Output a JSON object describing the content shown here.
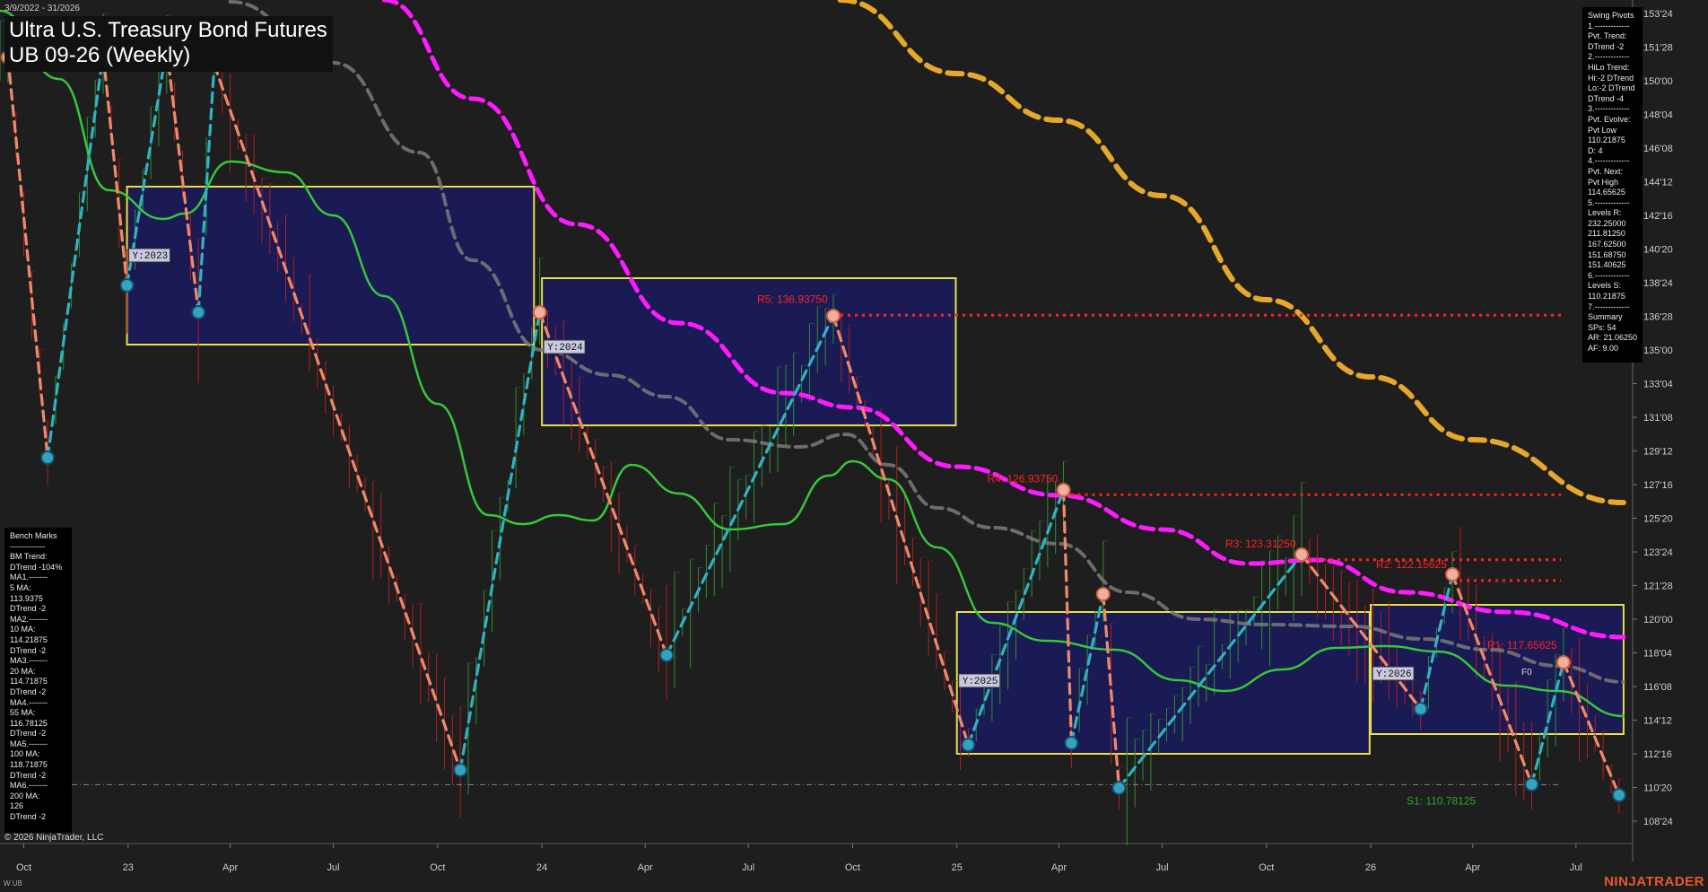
{
  "header": {
    "date_range": "3/9/2022 - 31/2026",
    "title_line1": "Ultra U.S. Treasury Bond Futures",
    "title_line2": "UB 09-26 (Weekly)"
  },
  "footer": {
    "copyright": "© 2026 NinjaTrader, LLC",
    "symbol": "W UB",
    "brand": "NINJATRADER"
  },
  "swing_pivots_panel": {
    "lines": [
      "Swing Pivots",
      "1.-------------",
      "Pvt. Trend:",
      "DTrend -2",
      "2.-------------",
      "HiLo Trend:",
      "Hi:-2 DTrend",
      "Lo:-2 DTrend",
      "DTrend -4",
      "3.-------------",
      "Pvt. Evolve:",
      "Pvt Low",
      "110.21875",
      "D: 4",
      "4.-------------",
      "Pvt. Next:",
      "Pvt High",
      "114.65625",
      "5.-------------",
      "Levels R:",
      "232.25000",
      "211.81250",
      "167.62500",
      "151.68750",
      "151.40625",
      "6.-------------",
      "Levels S:",
      "110.21875",
      "7.-------------",
      "Summary",
      "SPs: 54",
      "AR: 21.06250",
      "AF: 9.00"
    ]
  },
  "bench_marks_panel": {
    "lines": [
      "Bench Marks",
      "-------------",
      "BM Trend:",
      "DTrend -104%",
      "MA1.-------",
      "5 MA:",
      "113.9375",
      "DTrend -2",
      "MA2.-------",
      "10 MA:",
      "114.21875",
      "DTrend -2",
      "MA3.-------",
      "20 MA:",
      "114.71875",
      "DTrend -2",
      "MA4.-------",
      "55 MA:",
      "116.78125",
      "DTrend -2",
      "MA5.-------",
      "100 MA:",
      "118.71875",
      "DTrend -2",
      "MA6.-------",
      "200 MA:",
      "126",
      "DTrend -2"
    ]
  },
  "colors": {
    "background": "#1e1e1e",
    "up_swing": "#2fb3c4",
    "down_swing": "#f08a6a",
    "ma_green": "#35c83a",
    "ma_gray": "#7a7a7a",
    "ma_magenta": "#ff1aff",
    "ma_orange": "#e6a82a",
    "resistance": "#ff2222",
    "support": "#2ea52e",
    "year_box_fill": "#19195a",
    "year_box_border": "#e8e04a"
  },
  "chart_data": {
    "type": "line",
    "title": "Ultra U.S. Treasury Bond Futures UB 09-26 (Weekly)",
    "y_axis": {
      "ylim": [
        107.5,
        154.5
      ],
      "tick_values": [
        153.75,
        151.875,
        150.0,
        148.125,
        146.25,
        144.375,
        142.5,
        140.625,
        138.75,
        136.875,
        135.0,
        133.125,
        131.25,
        129.375,
        127.5,
        125.625,
        123.75,
        121.875,
        120.0,
        118.125,
        116.25,
        114.375,
        112.5,
        110.625,
        108.75
      ],
      "tick_labels": [
        "153'24",
        "151'28",
        "150'00",
        "148'04",
        "146'08",
        "144'12",
        "142'16",
        "140'20",
        "138'24",
        "136'28",
        "135'00",
        "133'04",
        "131'08",
        "129'12",
        "127'16",
        "125'20",
        "123'24",
        "121'28",
        "120'00",
        "118'04",
        "116'08",
        "114'12",
        "112'16",
        "110'20",
        "108'24"
      ]
    },
    "x_axis": {
      "xlim": [
        "2022-09-10",
        "2026-08-20"
      ],
      "ticks": [
        {
          "date": "2022-10-01",
          "label": "Oct"
        },
        {
          "date": "2023-01-01",
          "label": "23"
        },
        {
          "date": "2023-04-01",
          "label": "Apr"
        },
        {
          "date": "2023-07-01",
          "label": "Jul"
        },
        {
          "date": "2023-10-01",
          "label": "Oct"
        },
        {
          "date": "2024-01-01",
          "label": "24"
        },
        {
          "date": "2024-04-01",
          "label": "Apr"
        },
        {
          "date": "2024-07-01",
          "label": "Jul"
        },
        {
          "date": "2024-10-01",
          "label": "Oct"
        },
        {
          "date": "2025-01-01",
          "label": "25"
        },
        {
          "date": "2025-04-01",
          "label": "Apr"
        },
        {
          "date": "2025-07-01",
          "label": "Jul"
        },
        {
          "date": "2025-10-01",
          "label": "Oct"
        },
        {
          "date": "2026-01-01",
          "label": "26"
        },
        {
          "date": "2026-04-01",
          "label": "Apr"
        },
        {
          "date": "2026-07-01",
          "label": "Jul"
        }
      ]
    },
    "swing_pivots": [
      {
        "date": "2022-09-17",
        "y": 151.3,
        "kind": "high"
      },
      {
        "date": "2022-10-22",
        "y": 129.0,
        "kind": "low"
      },
      {
        "date": "2022-12-10",
        "y": 151.5,
        "kind": "high"
      },
      {
        "date": "2022-12-31",
        "y": 138.6,
        "kind": "low"
      },
      {
        "date": "2023-02-04",
        "y": 151.8,
        "kind": "high"
      },
      {
        "date": "2023-03-04",
        "y": 137.1,
        "kind": "low"
      },
      {
        "date": "2023-03-18",
        "y": 150.9,
        "kind": "high"
      },
      {
        "date": "2023-10-21",
        "y": 111.6,
        "kind": "low"
      },
      {
        "date": "2023-12-30",
        "y": 137.1,
        "kind": "high"
      },
      {
        "date": "2024-04-20",
        "y": 118.0,
        "kind": "low"
      },
      {
        "date": "2024-09-14",
        "y": 136.9,
        "kind": "high"
      },
      {
        "date": "2025-01-11",
        "y": 113.0,
        "kind": "low"
      },
      {
        "date": "2025-04-05",
        "y": 127.2,
        "kind": "high"
      },
      {
        "date": "2025-04-12",
        "y": 113.1,
        "kind": "low"
      },
      {
        "date": "2025-05-10",
        "y": 121.4,
        "kind": "high"
      },
      {
        "date": "2025-05-24",
        "y": 110.6,
        "kind": "low"
      },
      {
        "date": "2025-11-01",
        "y": 123.6,
        "kind": "high"
      },
      {
        "date": "2026-02-14",
        "y": 115.0,
        "kind": "low"
      },
      {
        "date": "2026-03-14",
        "y": 122.5,
        "kind": "high"
      },
      {
        "date": "2026-05-23",
        "y": 110.8,
        "kind": "low"
      },
      {
        "date": "2026-06-20",
        "y": 117.6,
        "kind": "high"
      },
      {
        "date": "2026-08-08",
        "y": 110.2,
        "kind": "low"
      }
    ],
    "moving_averages": [
      {
        "name": "green",
        "color": "#35c83a",
        "style": "solid",
        "points": [
          [
            "2022-09-10",
            153.9
          ],
          [
            "2022-11-01",
            150.1
          ],
          [
            "2022-12-15",
            143.9
          ],
          [
            "2023-02-01",
            142.3
          ],
          [
            "2023-02-20",
            142.6
          ],
          [
            "2023-04-01",
            145.5
          ],
          [
            "2023-05-20",
            144.9
          ],
          [
            "2023-07-01",
            142.5
          ],
          [
            "2023-08-15",
            138.0
          ],
          [
            "2023-10-01",
            132.0
          ],
          [
            "2023-11-15",
            125.8
          ],
          [
            "2023-12-15",
            125.3
          ],
          [
            "2024-01-15",
            125.8
          ],
          [
            "2024-02-15",
            125.5
          ],
          [
            "2024-03-20",
            128.6
          ],
          [
            "2024-05-01",
            127.0
          ],
          [
            "2024-06-15",
            125.0
          ],
          [
            "2024-08-01",
            125.3
          ],
          [
            "2024-09-10",
            128.0
          ],
          [
            "2024-10-01",
            128.8
          ],
          [
            "2024-11-01",
            127.8
          ],
          [
            "2024-12-15",
            124.0
          ],
          [
            "2025-02-01",
            119.8
          ],
          [
            "2025-03-20",
            118.8
          ],
          [
            "2025-05-20",
            118.3
          ],
          [
            "2025-07-15",
            116.6
          ],
          [
            "2025-08-25",
            116.0
          ],
          [
            "2025-10-15",
            117.2
          ],
          [
            "2025-12-01",
            118.4
          ],
          [
            "2026-01-15",
            118.5
          ],
          [
            "2026-03-01",
            118.2
          ],
          [
            "2026-05-01",
            116.3
          ],
          [
            "2026-06-15",
            116.0
          ],
          [
            "2026-08-12",
            114.6
          ]
        ]
      },
      {
        "name": "gray",
        "color": "#7a7a7a",
        "style": "dashed",
        "points": [
          [
            "2023-04-01",
            154.4
          ],
          [
            "2023-07-01",
            151.0
          ],
          [
            "2023-09-15",
            146.0
          ],
          [
            "2023-11-01",
            140.0
          ],
          [
            "2024-01-01",
            135.0
          ],
          [
            "2024-03-01",
            133.6
          ],
          [
            "2024-04-20",
            132.4
          ],
          [
            "2024-06-15",
            130.0
          ],
          [
            "2024-08-15",
            129.6
          ],
          [
            "2024-09-25",
            130.3
          ],
          [
            "2024-11-01",
            128.6
          ],
          [
            "2024-12-15",
            126.2
          ],
          [
            "2025-02-01",
            125.1
          ],
          [
            "2025-04-01",
            124.2
          ],
          [
            "2025-06-01",
            121.5
          ],
          [
            "2025-08-01",
            120.0
          ],
          [
            "2025-10-01",
            119.7
          ],
          [
            "2025-12-15",
            119.6
          ],
          [
            "2026-02-15",
            118.9
          ],
          [
            "2026-04-15",
            118.3
          ],
          [
            "2026-06-15",
            117.4
          ],
          [
            "2026-08-12",
            116.5
          ]
        ]
      },
      {
        "name": "magenta",
        "color": "#ff1aff",
        "style": "dashed",
        "points": [
          [
            "2023-08-15",
            154.5
          ],
          [
            "2023-11-01",
            149.0
          ],
          [
            "2024-02-01",
            142.0
          ],
          [
            "2024-05-01",
            136.5
          ],
          [
            "2024-08-01",
            132.6
          ],
          [
            "2024-10-01",
            131.8
          ],
          [
            "2025-01-01",
            128.5
          ],
          [
            "2025-04-01",
            126.9
          ],
          [
            "2025-07-01",
            125.0
          ],
          [
            "2025-09-15",
            123.1
          ],
          [
            "2025-11-15",
            123.3
          ],
          [
            "2026-02-01",
            121.5
          ],
          [
            "2026-05-01",
            120.4
          ],
          [
            "2026-08-12",
            119.0
          ]
        ]
      },
      {
        "name": "orange",
        "color": "#e6a82a",
        "style": "dashed",
        "points": [
          [
            "2024-09-20",
            154.5
          ],
          [
            "2025-01-01",
            150.4
          ],
          [
            "2025-04-01",
            147.8
          ],
          [
            "2025-07-01",
            143.6
          ],
          [
            "2025-10-01",
            137.8
          ],
          [
            "2026-01-01",
            133.5
          ],
          [
            "2026-04-01",
            130.0
          ],
          [
            "2026-08-12",
            126.5
          ]
        ]
      }
    ],
    "resistance_levels": [
      {
        "label": "R5: 136.93750",
        "y": 136.9375,
        "from": "2024-09-14"
      },
      {
        "label": "R4: 126.93750",
        "y": 126.9375,
        "from": "2025-04-05"
      },
      {
        "label": "R3: 123.31250",
        "y": 123.3125,
        "from": "2025-11-01"
      },
      {
        "label": "R2: 122.15625",
        "y": 122.15625,
        "from": "2026-03-14"
      },
      {
        "label": "R1: 117.65625",
        "y": 117.65625,
        "from": "2026-06-20"
      }
    ],
    "support_levels": [
      {
        "label": "S1: 110.78125",
        "y": 110.78125,
        "from": "2023-10-21"
      }
    ],
    "year_boxes": [
      {
        "label": "Y:2023",
        "x0": "2022-12-31",
        "x1": "2023-12-25",
        "y0": 135.3,
        "y1": 144.1
      },
      {
        "label": "Y:2024",
        "x0": "2024-01-01",
        "x1": "2024-12-31",
        "y0": 130.8,
        "y1": 139.0
      },
      {
        "label": "Y:2025",
        "x0": "2025-01-01",
        "x1": "2025-12-31",
        "y0": 112.5,
        "y1": 120.4
      },
      {
        "label": "Y:2026",
        "x0": "2026-01-01",
        "x1": "2026-08-12",
        "y0": 113.6,
        "y1": 120.8
      }
    ],
    "current_price_marker": {
      "label": "F0",
      "y": 117.4
    }
  }
}
